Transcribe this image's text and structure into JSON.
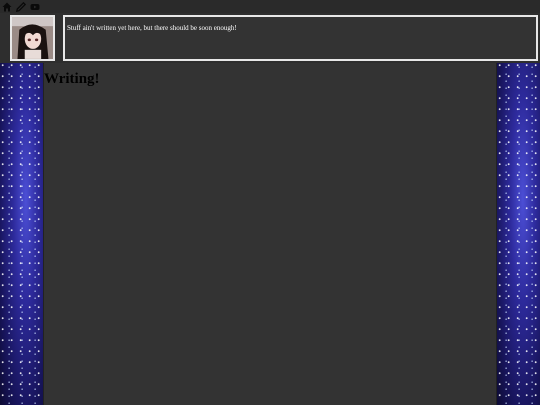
{
  "nav": {
    "icons": [
      "home-icon",
      "pencil-icon",
      "youtube-icon"
    ]
  },
  "header": {
    "status_text": "Stuff ain't written yet here, but there should be soon enough!"
  },
  "main": {
    "title": "Writing!"
  },
  "colors": {
    "page_bg": "#333333",
    "border": "#e8e8e8",
    "space_blue": "#2d2a9c"
  }
}
